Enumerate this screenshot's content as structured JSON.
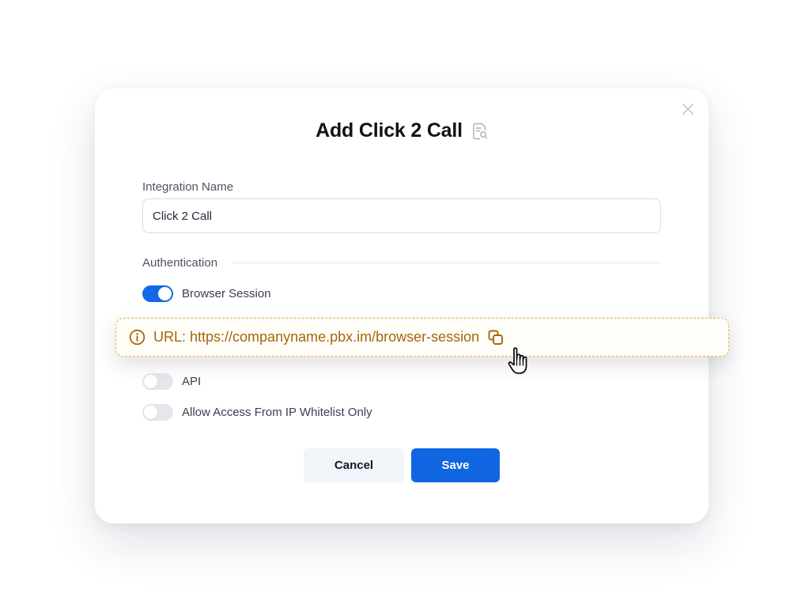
{
  "dialog": {
    "title": "Add Click 2 Call",
    "title_icon": "document-search-icon",
    "close_icon": "close-icon"
  },
  "integration_name": {
    "label": "Integration Name",
    "value": "Click 2 Call"
  },
  "authentication": {
    "section_label": "Authentication",
    "options": [
      {
        "label": "Browser Session",
        "enabled": true
      },
      {
        "label": "API",
        "enabled": false
      },
      {
        "label": "Allow Access From IP Whitelist Only",
        "enabled": false
      }
    ]
  },
  "url_banner": {
    "text": "URL: https://companyname.pbx.im/browser-session",
    "info_icon": "info-icon",
    "copy_icon": "copy-icon",
    "cursor_icon": "hand-pointer-icon"
  },
  "actions": {
    "cancel_label": "Cancel",
    "save_label": "Save"
  },
  "colors": {
    "primary": "#0f66e0",
    "toggle_on": "#1368e8",
    "toggle_off": "#e4e7ec",
    "banner_accent": "#a7660a",
    "banner_border": "#e6b73c"
  }
}
